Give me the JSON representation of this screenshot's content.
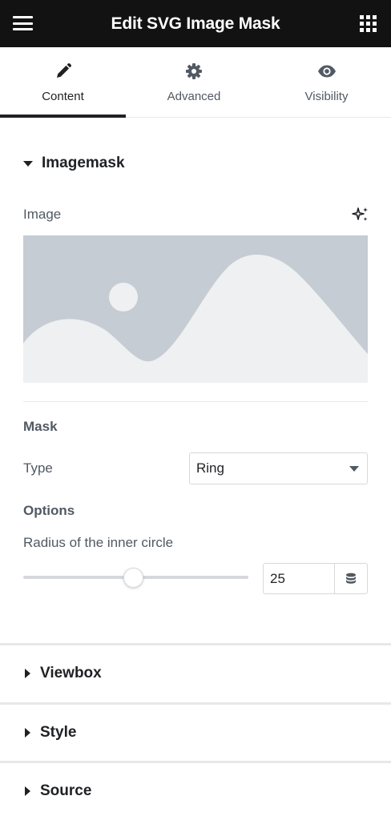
{
  "header": {
    "title": "Edit SVG Image Mask",
    "menu_icon": "hamburger-icon",
    "apps_icon": "grid-icon"
  },
  "tabs": [
    {
      "label": "Content",
      "icon": "pencil-icon",
      "active": true
    },
    {
      "label": "Advanced",
      "icon": "gear-icon",
      "active": false
    },
    {
      "label": "Visibility",
      "icon": "eye-icon",
      "active": false
    }
  ],
  "section": {
    "title": "Imagemask",
    "image_label": "Image",
    "ai_icon": "sparkle-icon",
    "mask_heading": "Mask",
    "type_label": "Type",
    "type_value": "Ring",
    "options_heading": "Options",
    "radius_label": "Radius of the inner circle",
    "radius_value": "25",
    "radius_fraction": 0.49,
    "dynamic_icon": "database-icon"
  },
  "collapsed_sections": [
    {
      "title": "Viewbox"
    },
    {
      "title": "Style"
    },
    {
      "title": "Source"
    }
  ],
  "colors": {
    "header_bg": "#121212",
    "placeholder_bg": "#c5ccd3",
    "placeholder_shape": "#eef0f2",
    "text_primary": "#1f2124",
    "text_secondary": "#515962",
    "border": "#d5d8dc"
  }
}
